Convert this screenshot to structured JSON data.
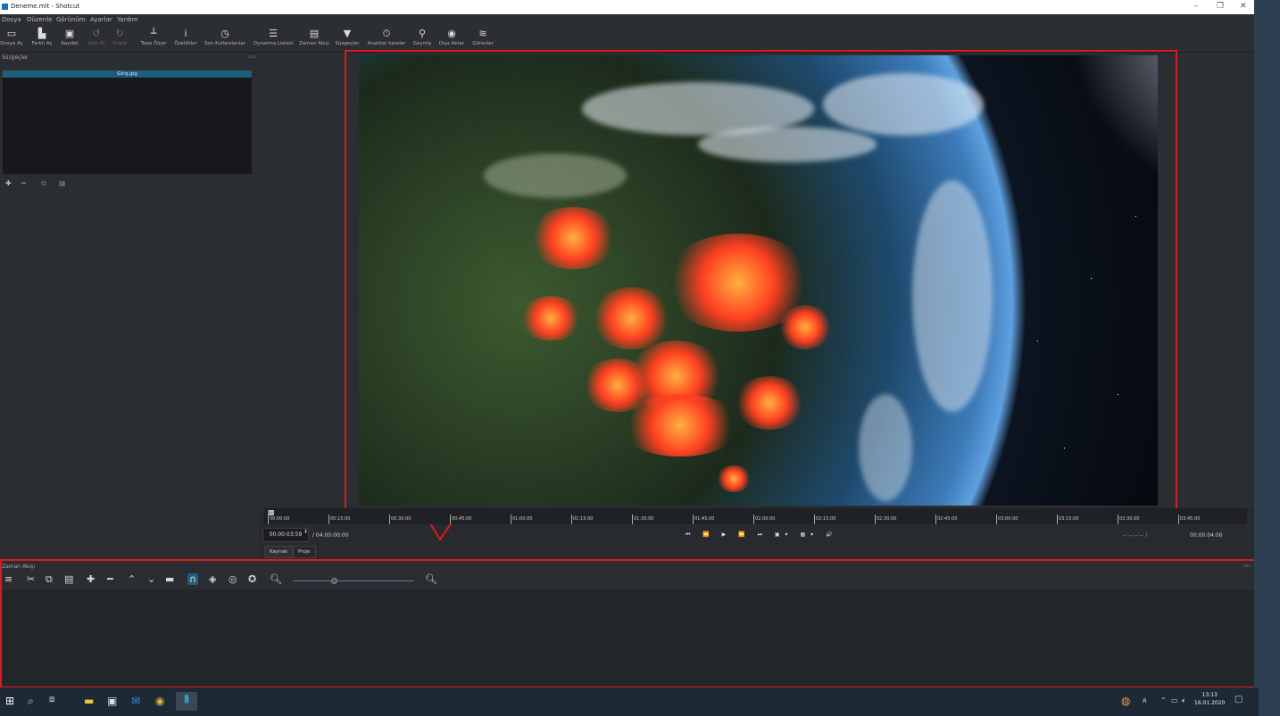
{
  "window": {
    "title": "Deneme.mlt - Shotcut",
    "controls": [
      "–",
      "❐",
      "✕"
    ]
  },
  "menu": [
    "Dosya",
    "Düzenle",
    "Görünüm",
    "Ayarlar",
    "Yardım"
  ],
  "toolbar": [
    {
      "label": "Dosya Aç",
      "icon": "folder-open-icon",
      "glyph": "▭",
      "enabled": true
    },
    {
      "label": "Farklı Aç",
      "icon": "open-other-icon",
      "glyph": "▙",
      "enabled": true
    },
    {
      "label": "Kaydet",
      "icon": "save-icon",
      "glyph": "▣",
      "enabled": true
    },
    {
      "label": "Geri Al",
      "icon": "undo-icon",
      "glyph": "↺",
      "enabled": false
    },
    {
      "label": "Yinele",
      "icon": "redo-icon",
      "glyph": "↻",
      "enabled": false
    },
    {
      "label": "Tepe Ölçer",
      "icon": "peak-meter-icon",
      "glyph": "┴",
      "enabled": true
    },
    {
      "label": "Özellikler",
      "icon": "info-icon",
      "glyph": "i",
      "enabled": true
    },
    {
      "label": "Son Kullanılanlar",
      "icon": "recent-icon",
      "glyph": "◷",
      "enabled": true
    },
    {
      "label": "Oynatma Listesi",
      "icon": "playlist-icon",
      "glyph": "☰",
      "enabled": true
    },
    {
      "label": "Zaman Akışı",
      "icon": "timeline-icon",
      "glyph": "▤",
      "enabled": true
    },
    {
      "label": "Süzgeçler",
      "icon": "filter-icon",
      "glyph": "▼",
      "enabled": true
    },
    {
      "label": "Anahtar kareler",
      "icon": "keyframes-icon",
      "glyph": "⏱",
      "enabled": true
    },
    {
      "label": "Geçmiş",
      "icon": "history-icon",
      "glyph": "⚲",
      "enabled": true
    },
    {
      "label": "Dışa Aktar",
      "icon": "export-icon",
      "glyph": "◉",
      "enabled": true
    },
    {
      "label": "Görevler",
      "icon": "jobs-icon",
      "glyph": "≋",
      "enabled": true
    }
  ],
  "filters_panel": {
    "title": "Süzgeçler",
    "selected_clip": "Giriş.jpg",
    "buttons": [
      "✚",
      "━",
      "⧉",
      "▦"
    ]
  },
  "ruler": {
    "labels": [
      "00:00:00",
      "00:15:00",
      "00:30:00",
      "00:45:00",
      "01:00:00",
      "01:15:00",
      "01:30:00",
      "01:45:00",
      "02:00:00",
      "02:15:00",
      "02:30:00",
      "02:45:00",
      "03:00:00",
      "03:15:00",
      "03:30:00",
      "03:45:00"
    ]
  },
  "transport": {
    "timecode": "00:00:03:59",
    "duration": "/ 04:00:00:00",
    "controls": "⏮ ⏪ ▶ ⏩ ⏭ ▣▾ ▦▾ 🔊",
    "in_point": "--:--:--:-- /",
    "out_point": "00:00:04:00"
  },
  "tabs": [
    "Kaynak",
    "Proje"
  ],
  "timeline": {
    "title": "Zaman Akışı"
  },
  "taskbar": {
    "time": "13:13",
    "date": "16.01.2020"
  },
  "colors": {
    "highlight": "#e01818",
    "accent": "#1e5f7a"
  }
}
